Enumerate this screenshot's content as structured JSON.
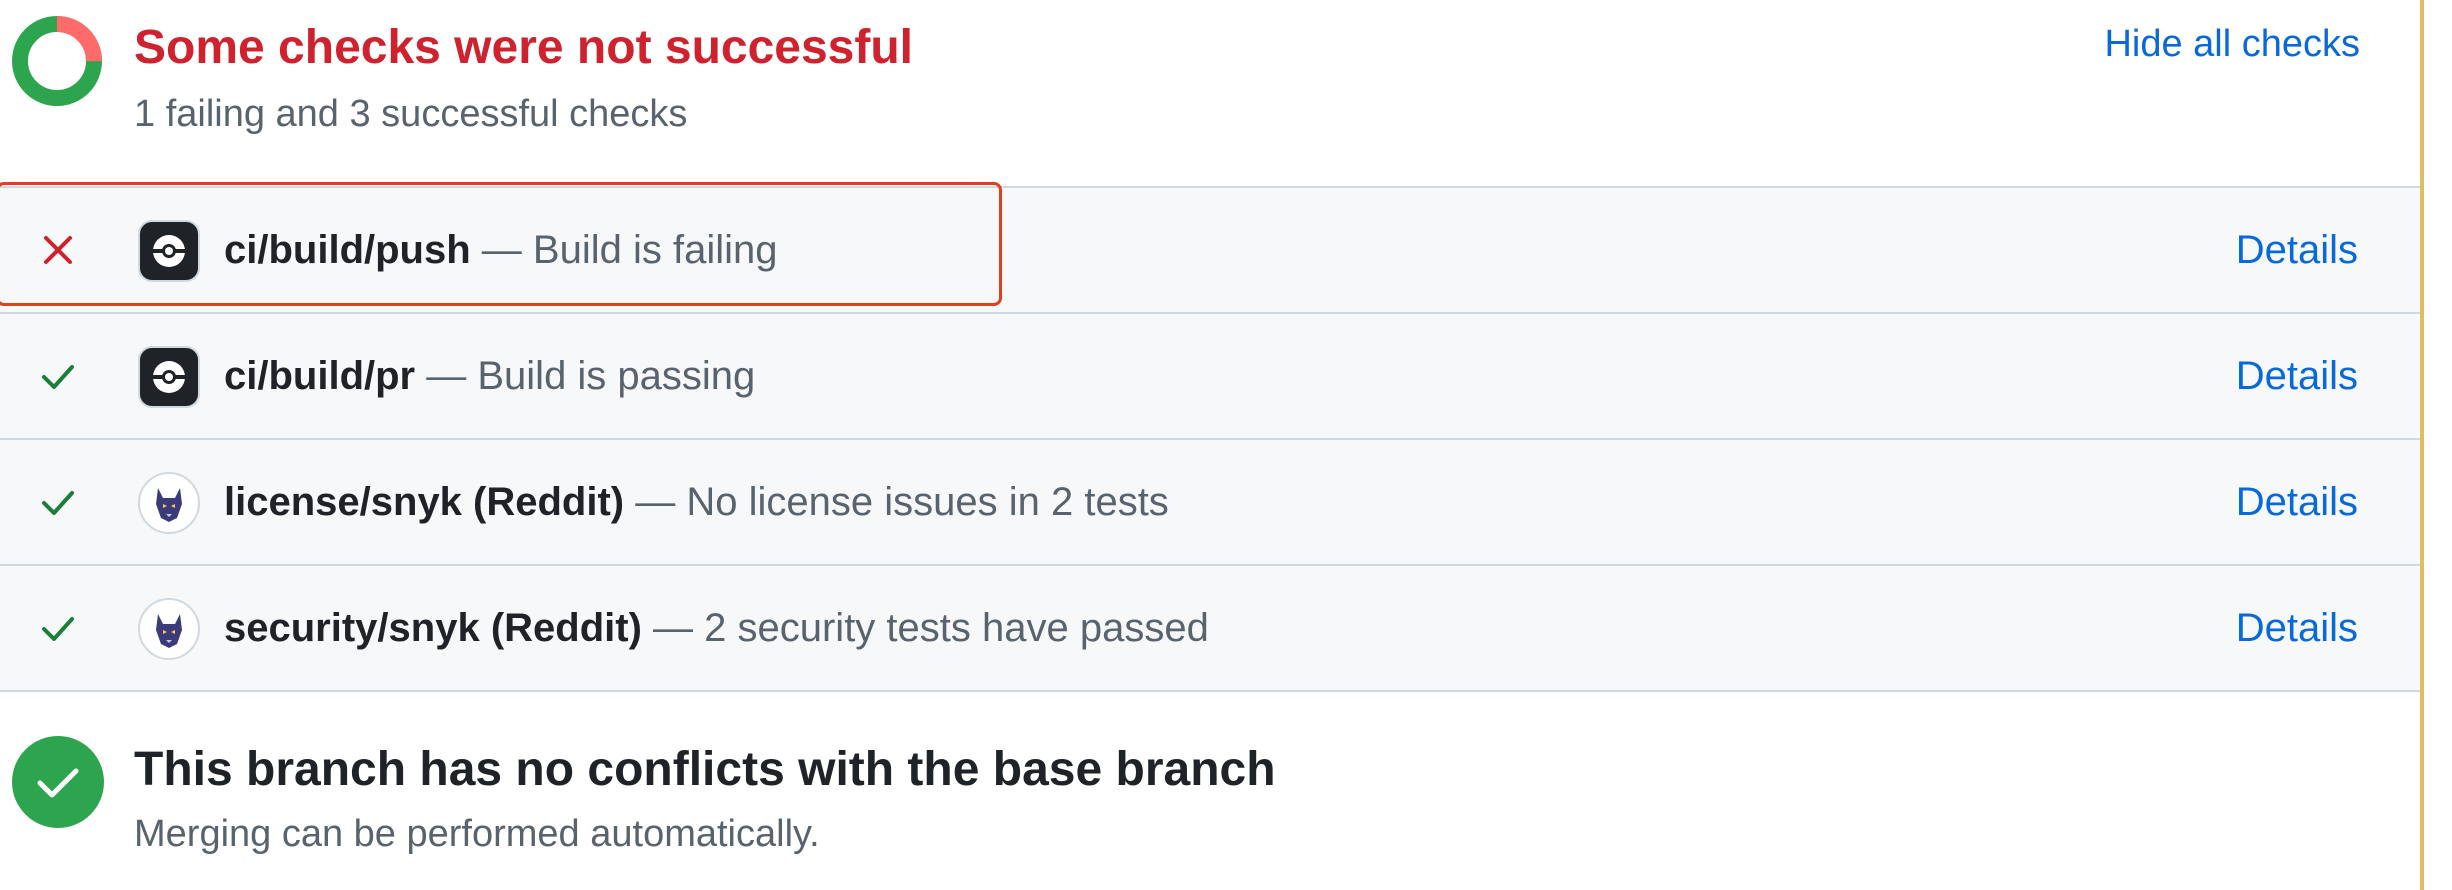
{
  "summary": {
    "title": "Some checks were not successful",
    "subtitle": "1 failing and 3 successful checks",
    "hide_link": "Hide all checks",
    "failing_fraction": 0.25,
    "colors": {
      "failing": "#cf222e",
      "success": "#2da44e"
    }
  },
  "checks": [
    {
      "status": "failing",
      "status_icon": "x-icon",
      "app_icon": "build-app-icon",
      "name": "ci/build/push",
      "description": "— Build is failing",
      "details_label": "Details"
    },
    {
      "status": "passing",
      "status_icon": "check-icon",
      "app_icon": "build-app-icon",
      "name": "ci/build/pr",
      "description": "— Build is passing",
      "details_label": "Details"
    },
    {
      "status": "passing",
      "status_icon": "check-icon",
      "app_icon": "snyk-icon",
      "name": "license/snyk (Reddit)",
      "description": "— No license issues in 2 tests",
      "details_label": "Details"
    },
    {
      "status": "passing",
      "status_icon": "check-icon",
      "app_icon": "snyk-icon",
      "name": "security/snyk (Reddit)",
      "description": "— 2 security tests have passed",
      "details_label": "Details"
    }
  ],
  "merge": {
    "title": "This branch has no conflicts with the base branch",
    "subtitle": "Merging can be performed automatically.",
    "icon": "check-circle-icon",
    "color": "#2da44e"
  },
  "highlight": {
    "color": "#e0401e"
  }
}
